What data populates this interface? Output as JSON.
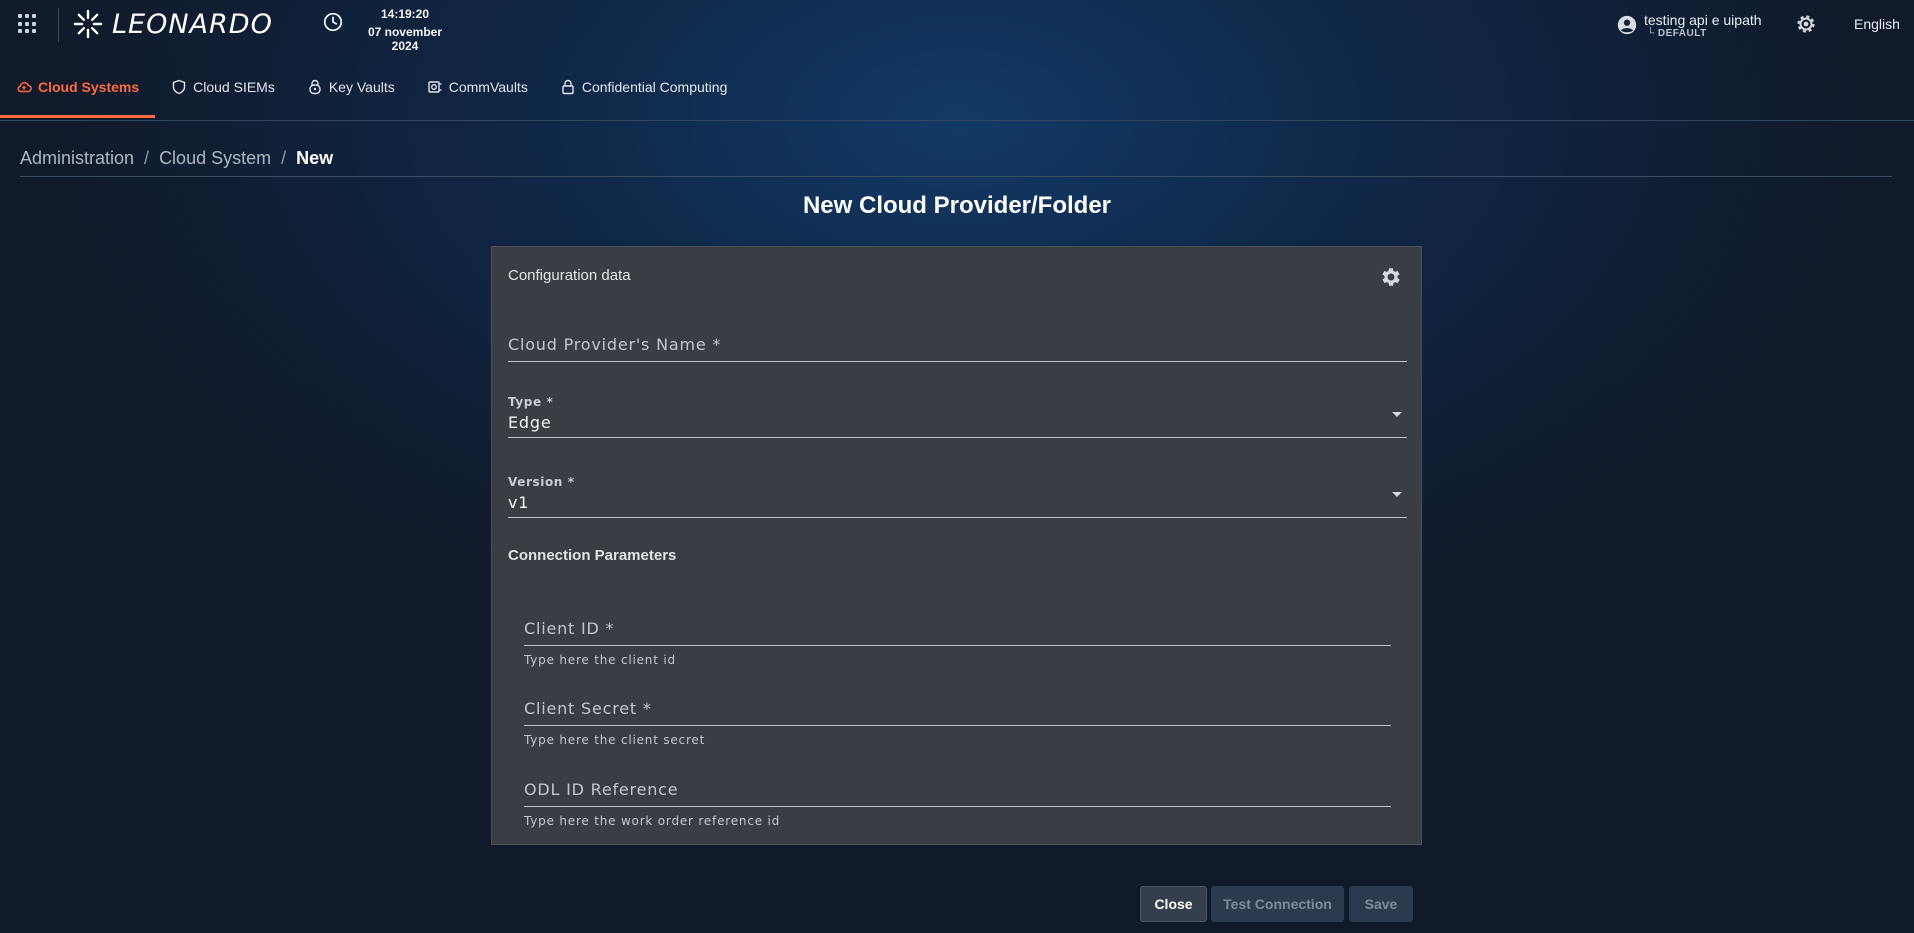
{
  "header": {
    "logo_text": "LEONARDO",
    "time": "14:19:20",
    "date": "07 november 2024",
    "user_name": "testing api e uipath",
    "workspace": "└ DEFAULT",
    "language": "English"
  },
  "tabs": [
    {
      "label": "Cloud Systems",
      "icon": "cloud-icon",
      "active": true
    },
    {
      "label": "Cloud SIEMs",
      "icon": "shield-icon"
    },
    {
      "label": "Key Vaults",
      "icon": "key-lock-icon"
    },
    {
      "label": "CommVaults",
      "icon": "vault-icon"
    },
    {
      "label": "Confidential Computing",
      "icon": "lock-icon"
    }
  ],
  "breadcrumb": {
    "items": [
      "Administration",
      "Cloud System"
    ],
    "current": "New",
    "separator": "/"
  },
  "page_title": "New Cloud Provider/Folder",
  "card": {
    "header": "Configuration data",
    "provider_name_label": "Cloud Provider's Name *",
    "type_label": "Type *",
    "type_value": "Edge",
    "version_label": "Version *",
    "version_value": "v1",
    "section_title": "Connection Parameters",
    "client_id_label": "Client ID *",
    "client_id_hint": "Type here the client id",
    "client_secret_label": "Client Secret *",
    "client_secret_hint": "Type here the client secret",
    "odl_label": "ODL ID Reference",
    "odl_hint": "Type here the work order reference id"
  },
  "buttons": {
    "close": "Close",
    "test": "Test Connection",
    "save": "Save"
  },
  "colors": {
    "accent": "#ff6a3d",
    "card_bg": "#3a3d44"
  }
}
